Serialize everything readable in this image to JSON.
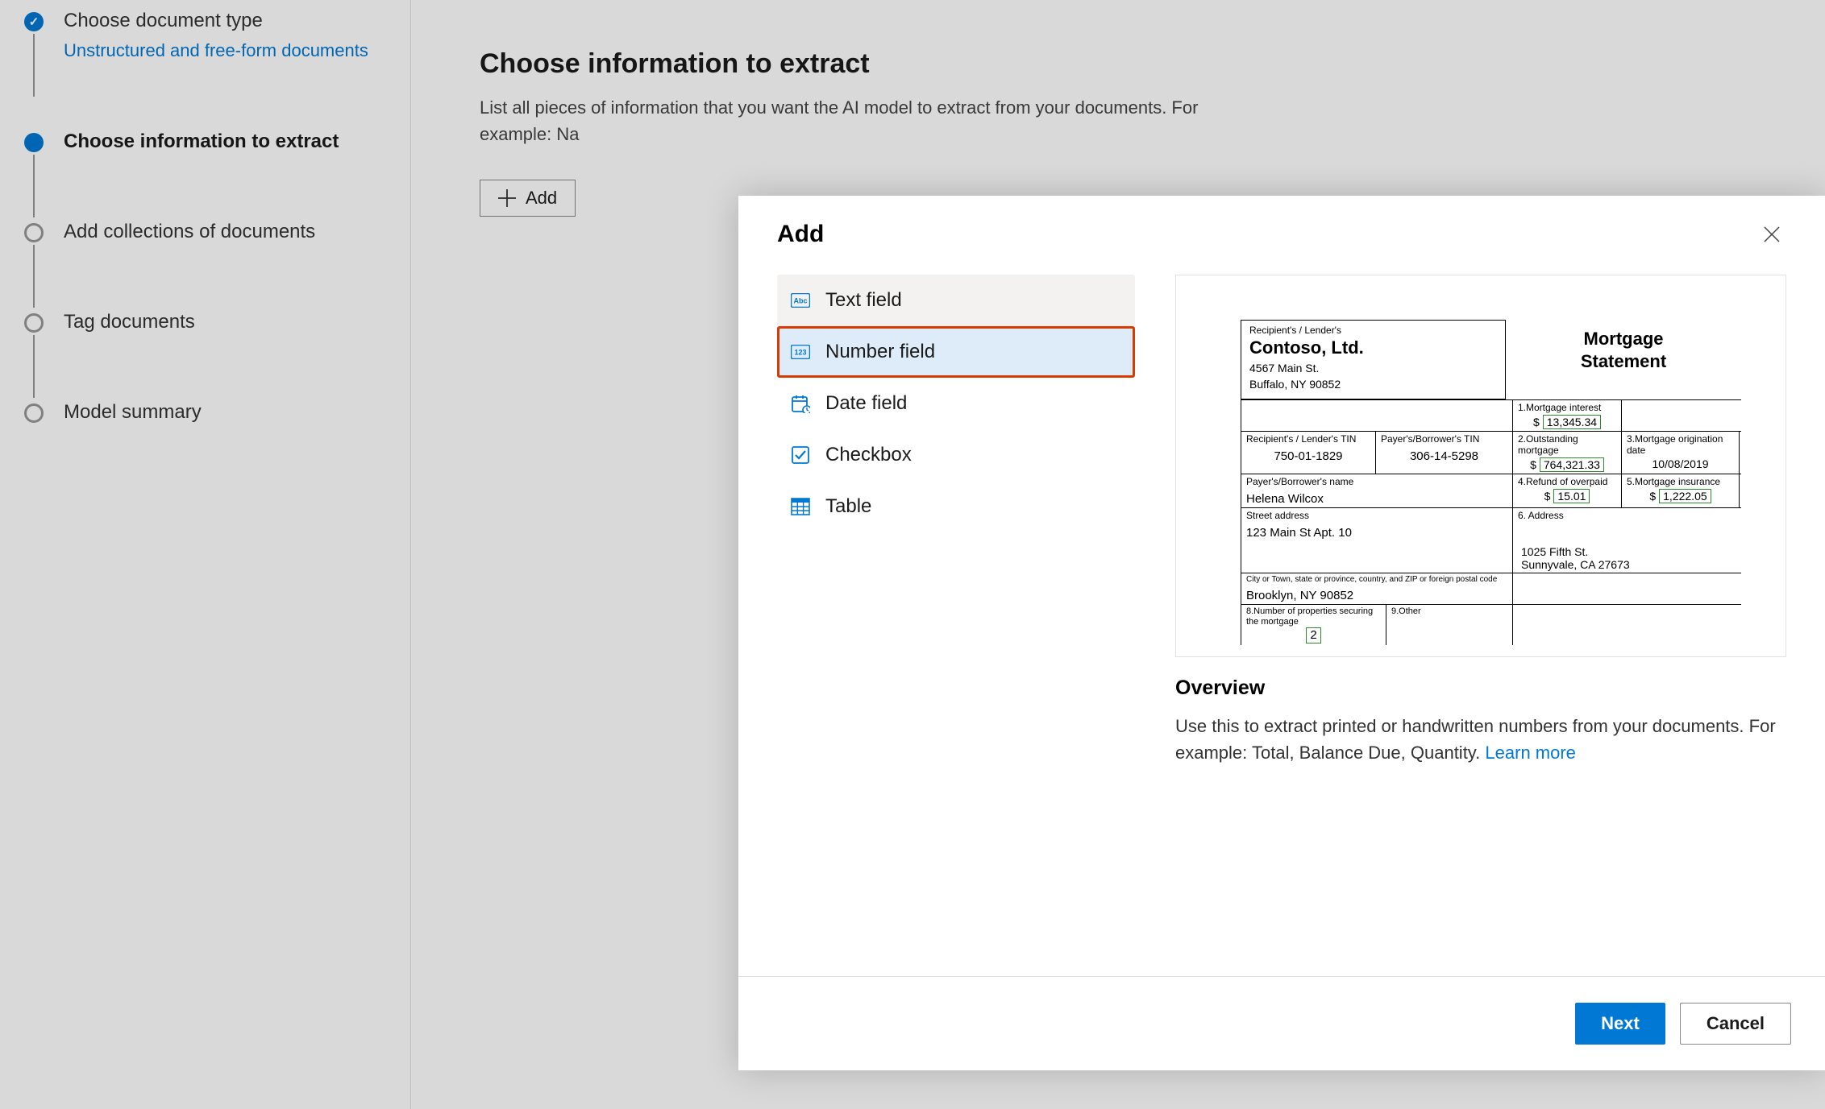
{
  "sidebar": {
    "steps": [
      {
        "title": "Choose document type",
        "subtitle": "Unstructured and free-form documents"
      },
      {
        "title": "Choose information to extract"
      },
      {
        "title": "Add collections of documents"
      },
      {
        "title": "Tag documents"
      },
      {
        "title": "Model summary"
      }
    ]
  },
  "main": {
    "title": "Choose information to extract",
    "subtitle_line1": "List all pieces of information that you want the AI model to extract from your documents. For",
    "subtitle_line2": "example: Na",
    "add_button": "Add"
  },
  "modal": {
    "title": "Add",
    "field_types": [
      {
        "label": "Text field",
        "icon": "text-icon"
      },
      {
        "label": "Number field",
        "icon": "number-icon"
      },
      {
        "label": "Date field",
        "icon": "date-icon"
      },
      {
        "label": "Checkbox",
        "icon": "checkbox-icon"
      },
      {
        "label": "Table",
        "icon": "table-icon"
      }
    ],
    "overview": {
      "title": "Overview",
      "text": "Use this to extract printed or handwritten numbers from your documents. For example: Total, Balance Due, Quantity. ",
      "link": "Learn more"
    },
    "footer": {
      "next": "Next",
      "cancel": "Cancel"
    }
  },
  "doc_preview": {
    "rec_lender_label": "Recipient's / Lender's",
    "company_name": "Contoso, Ltd.",
    "company_addr1": "4567 Main St.",
    "company_addr2": "Buffalo, NY 90852",
    "title_line1": "Mortgage",
    "title_line2": "Statement",
    "cell_interest_label": "1.Mortgage interest",
    "cell_interest_val": "13,345.34",
    "cell_rectin_label": "Recipient's / Lender's TIN",
    "cell_rectin_val": "750-01-1829",
    "cell_paytin_label": "Payer's/Borrower's TIN",
    "cell_paytin_val": "306-14-5298",
    "cell_outstanding_label": "2.Outstanding mortgage",
    "cell_outstanding_val": "764,321.33",
    "cell_orig_label": "3.Mortgage origination date",
    "cell_orig_val": "10/08/2019",
    "cell_borrower_name_label": "Payer's/Borrower's name",
    "cell_borrower_name_val": "Helena Wilcox",
    "cell_refund_label": "4.Refund of overpaid",
    "cell_refund_val": "15.01",
    "cell_insurance_label": "5.Mortgage insurance",
    "cell_insurance_val": "1,222.05",
    "cell_street_label": "Street address",
    "cell_street_val": "123 Main St Apt. 10",
    "cell_addr6_label": "6. Address",
    "cell_city_label": "City or Town, state or province, country, and ZIP or foreign postal code",
    "cell_city_val": "Brooklyn, NY 90852",
    "cell_props_label": "8.Number of properties securing the mortgage",
    "cell_props_val": "2",
    "cell_other_label": "9.Other",
    "footer_addr1": "1025 Fifth St.",
    "footer_addr2": "Sunnyvale, CA 27673"
  }
}
